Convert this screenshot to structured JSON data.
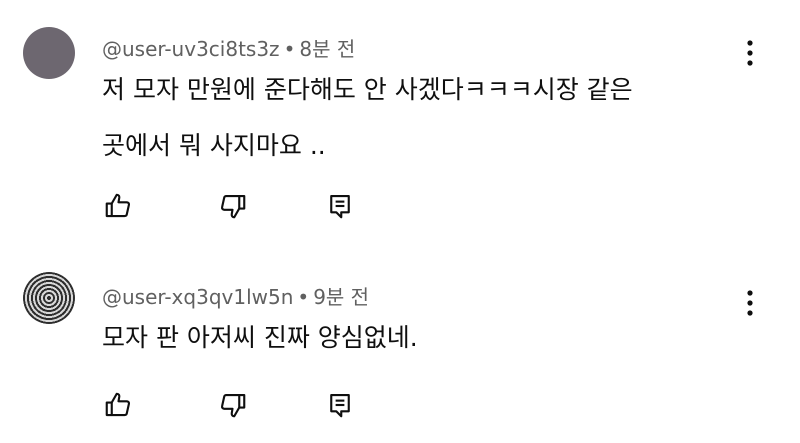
{
  "comments": [
    {
      "user": "@user-uv3ci8ts3z",
      "separator": "•",
      "time": "8분 전",
      "line1": "저 모자 만원에 준다해도 안 사겠다ㅋㅋㅋ시장 같은",
      "line2": "곳에서 뭐 사지마요 ..",
      "avatar_color": "#6d6770"
    },
    {
      "user": "@user-xq3qv1lw5n",
      "separator": "•",
      "time": "9분 전",
      "line1": "모자 판 아저씨 진짜 양심없네.",
      "avatar_style": "spiral"
    }
  ],
  "icons": {
    "like": "thumbs-up-icon",
    "dislike": "thumbs-down-icon",
    "reply": "reply-icon",
    "more": "more-vertical-icon"
  }
}
